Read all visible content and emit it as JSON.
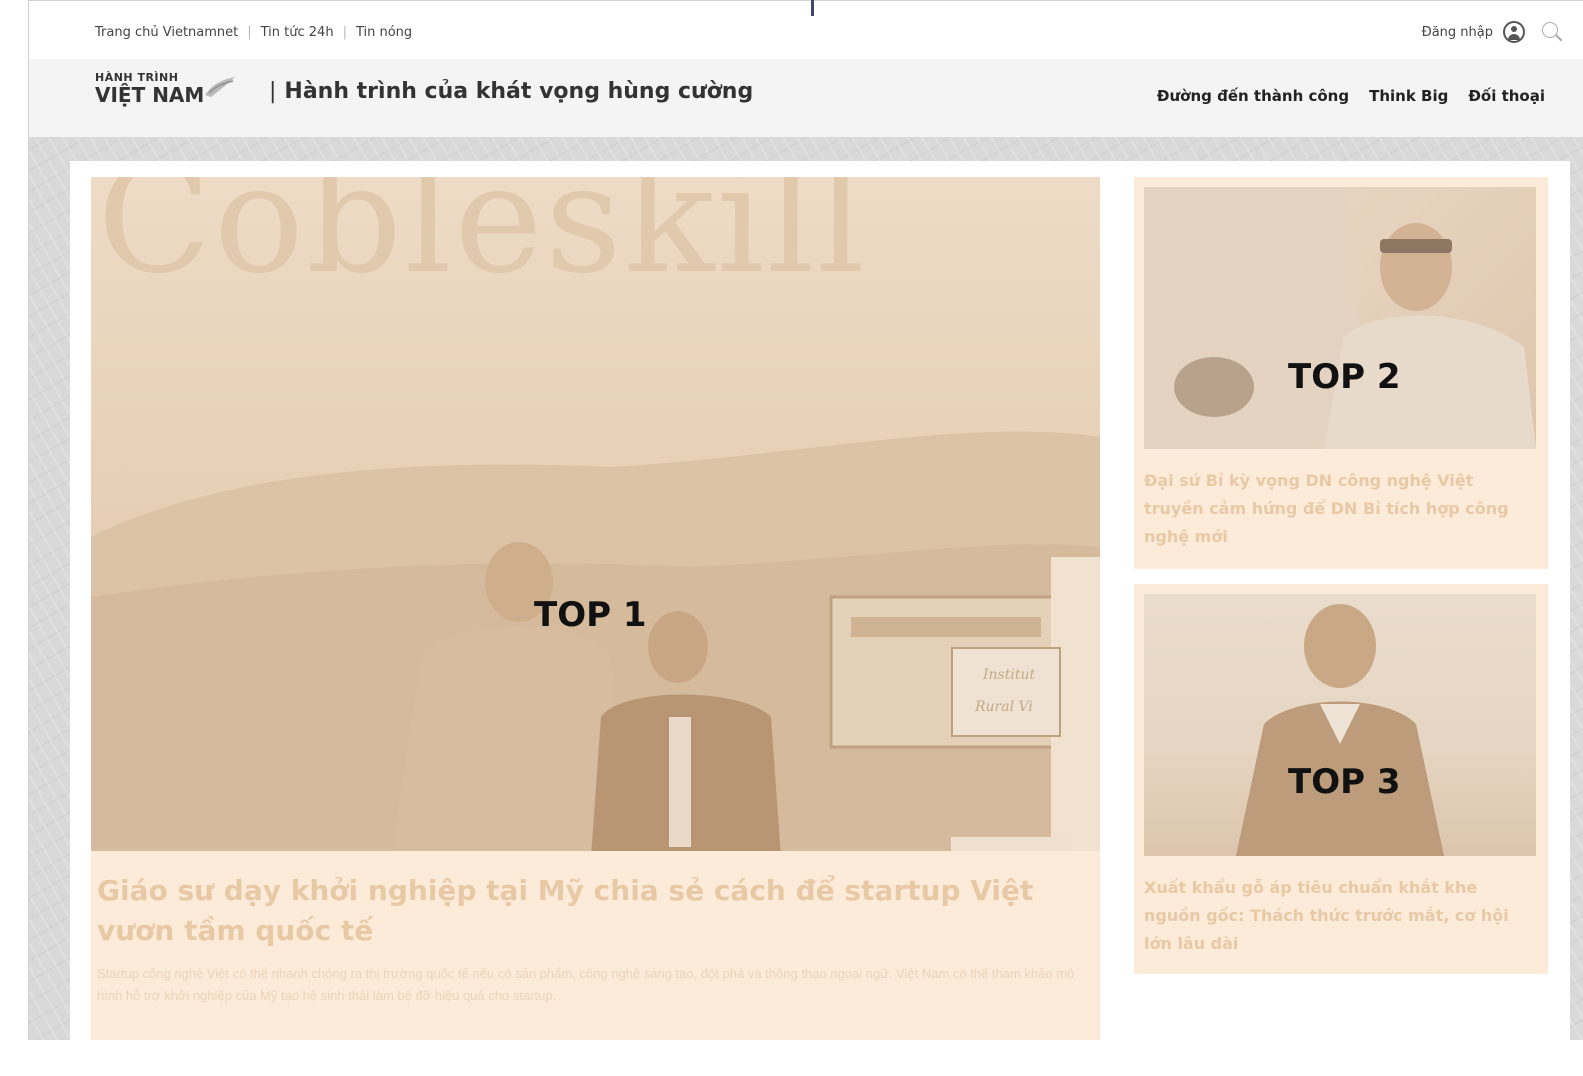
{
  "topbar": {
    "links": [
      "Trang chủ Vietnamnet",
      "Tin tức 24h",
      "Tin nóng"
    ],
    "login_label": "Đăng nhập"
  },
  "header": {
    "logo_line1": "HÀNH TRÌNH",
    "logo_line2": "VIỆT NAM",
    "tagline": "Hành trình của khát vọng hùng cường",
    "nav": [
      "Đường đến thành công",
      "Think Big",
      "Đối thoại"
    ]
  },
  "top1": {
    "rank": "TOP 1",
    "photo_text": "Cobleskill",
    "sign_text_1": "Institut",
    "sign_text_2": "Rural Vi",
    "title": "Giáo sư dạy khởi nghiệp tại Mỹ chia sẻ cách để startup Việt vươn tầm quốc tế",
    "sapo": "Startup công nghệ Việt có thể nhanh chóng ra thị trường quốc tế nếu có sản phẩm, công nghệ sáng tạo, đột phá và thông thạo ngoại ngữ. Việt Nam có thể tham khảo mô hình hỗ trợ khởi nghiệp của Mỹ tạo hệ sinh thái làm bệ đỡ hiệu quả cho startup."
  },
  "top2": {
    "rank": "TOP 2",
    "title": "Đại sứ Bỉ kỳ vọng DN công nghệ Việt truyền cảm hứng để DN Bỉ tích hợp công nghệ mới"
  },
  "top3": {
    "rank": "TOP 3",
    "title": "Xuất khẩu gỗ áp tiêu chuẩn khắt khe nguồn gốc: Thách thức trước mắt, cơ hội lớn lâu dài"
  },
  "colors": {
    "highlight": "#fcebd9",
    "title_faded": "#e7c9a6",
    "header_bg": "#f4f4f4"
  }
}
